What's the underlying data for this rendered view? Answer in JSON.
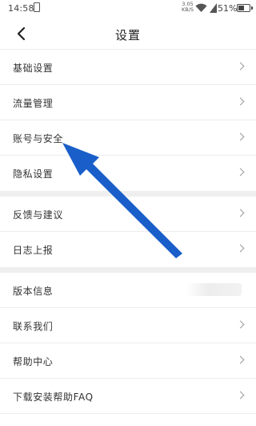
{
  "status_bar": {
    "time": "14:58",
    "speed_value": "3.05",
    "speed_unit": "KB/S",
    "battery_percent": "51%",
    "battery_level": 0.51
  },
  "nav": {
    "title": "设置"
  },
  "sections": [
    {
      "items": [
        {
          "label": "基础设置"
        },
        {
          "label": "流量管理"
        },
        {
          "label": "账号与安全"
        },
        {
          "label": "隐私设置"
        }
      ]
    },
    {
      "items": [
        {
          "label": "反馈与建议"
        },
        {
          "label": "日志上报"
        }
      ]
    },
    {
      "items": [
        {
          "label": "版本信息"
        },
        {
          "label": "联系我们"
        },
        {
          "label": "帮助中心"
        },
        {
          "label": "下载安装帮助FAQ"
        }
      ]
    }
  ],
  "annotation": {
    "color": "#1a5fc9",
    "icon": "arrow-pointer-icon"
  }
}
